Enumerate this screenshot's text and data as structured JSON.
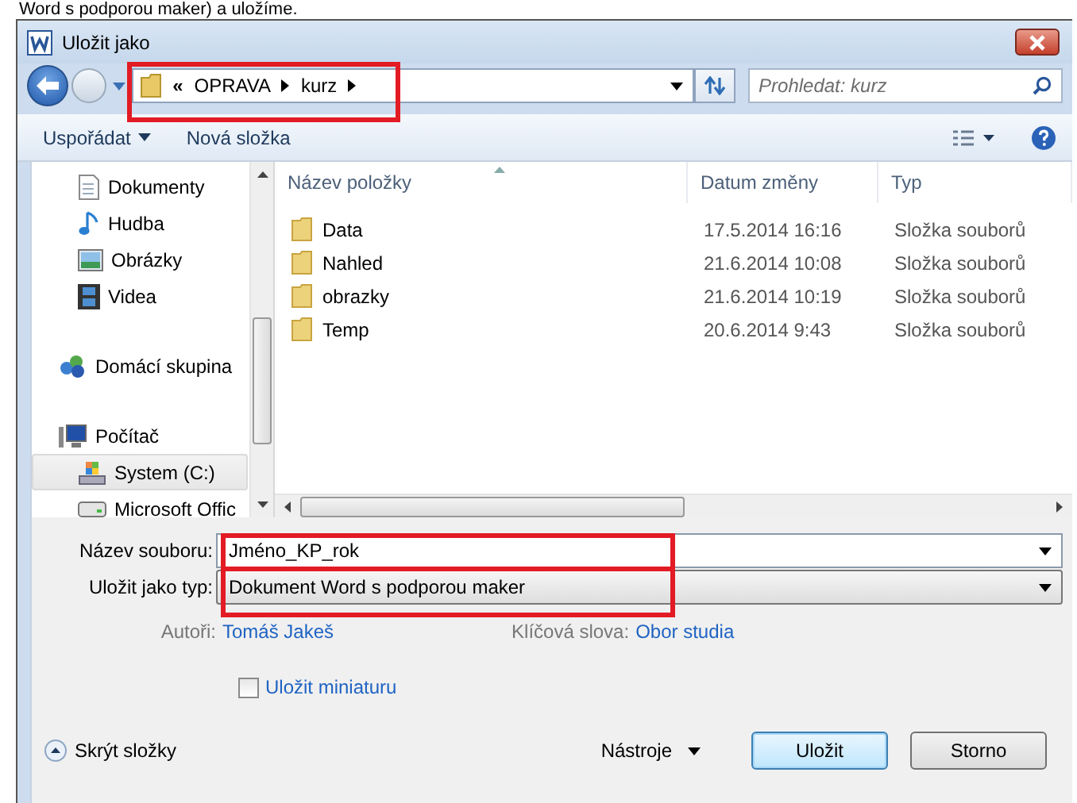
{
  "caption": "Word s podporou maker) a uložíme.",
  "window": {
    "title": "Uložit jako"
  },
  "address": {
    "overflow": "«",
    "crumbs": [
      "OPRAVA",
      "kurz"
    ]
  },
  "search": {
    "placeholder": "Prohledat: kurz"
  },
  "toolbar": {
    "organize": "Uspořádat",
    "new_folder": "Nová složka"
  },
  "nav": [
    {
      "label": "Dokumenty",
      "kind": "document",
      "selected": false
    },
    {
      "label": "Hudba",
      "kind": "music",
      "selected": false
    },
    {
      "label": "Obrázky",
      "kind": "picture",
      "selected": false
    },
    {
      "label": "Videa",
      "kind": "video",
      "selected": false
    },
    {
      "label": "Domácí skupina",
      "kind": "homegroup",
      "selected": false
    },
    {
      "label": "Počítač",
      "kind": "computer",
      "selected": false
    },
    {
      "label": "System (C:)",
      "kind": "system-drive",
      "selected": false,
      "hover": true
    },
    {
      "label": "Microsoft Offic",
      "kind": "drive",
      "selected": false
    }
  ],
  "table": {
    "columns": [
      "Název položky",
      "Datum změny",
      "Typ"
    ],
    "rows": [
      {
        "name": "Data",
        "date": "17.5.2014 16:16",
        "type": "Složka souborů"
      },
      {
        "name": "Nahled",
        "date": "21.6.2014 10:08",
        "type": "Složka souborů"
      },
      {
        "name": "obrazky",
        "date": "21.6.2014 10:19",
        "type": "Složka souborů"
      },
      {
        "name": "Temp",
        "date": "20.6.2014 9:43",
        "type": "Složka souborů"
      }
    ]
  },
  "form": {
    "filename_label": "Název souboru:",
    "filename": "Jméno_KP_rok",
    "type_label": "Uložit jako typ:",
    "type": "Dokument Word s podporou maker",
    "authors_label": "Autoři:",
    "authors": "Tomáš Jakeš",
    "keywords_label": "Klíčová slova:",
    "keywords": "Obor studia",
    "thumbnail": {
      "label": "Uložit miniaturu",
      "checked": false
    }
  },
  "footer": {
    "hide_folders": "Skrýt složky",
    "tools": "Nástroje",
    "save": "Uložit",
    "cancel": "Storno"
  }
}
